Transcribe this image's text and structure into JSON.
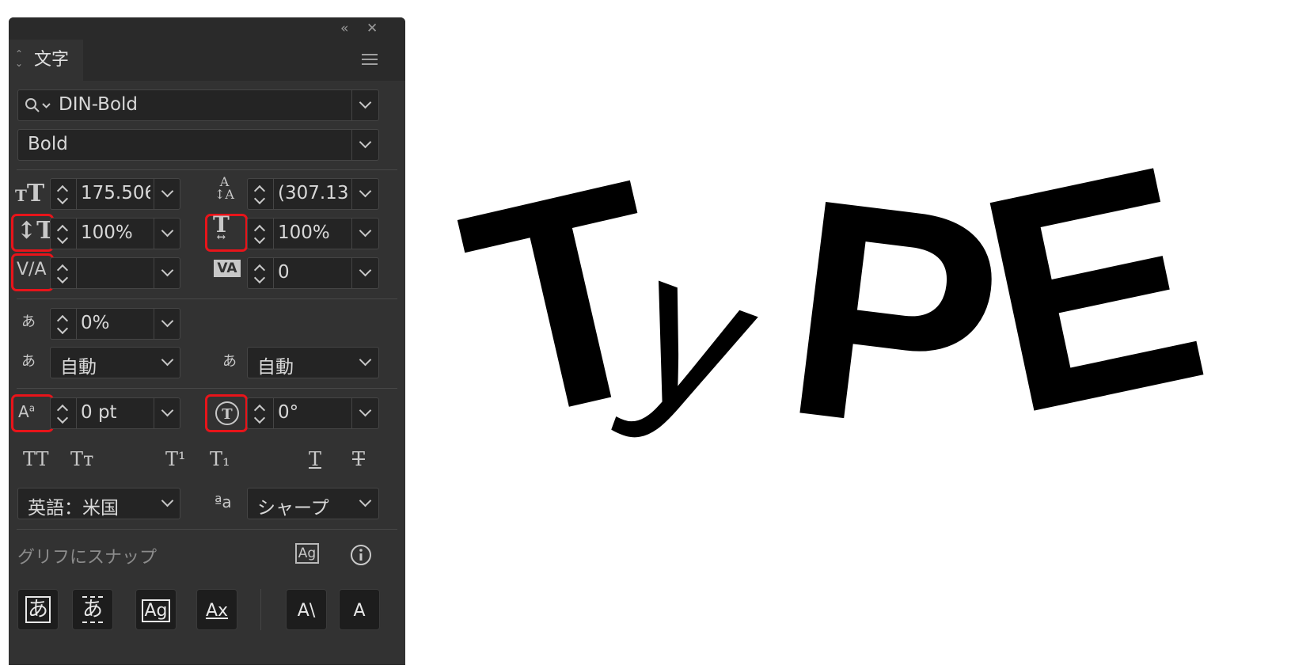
{
  "panel": {
    "title_icons": {
      "collapse": "«",
      "close": "✕"
    },
    "tab_label": "文字",
    "menu_icon": "hamburger-menu-icon",
    "font_family": "DIN-Bold",
    "font_style": "Bold",
    "font_size": "175.506",
    "leading": "(307.13",
    "vertical_scale": "100%",
    "horizontal_scale": "100%",
    "kerning": "",
    "tracking": "0",
    "tsume": "0%",
    "aki_left": "自動",
    "aki_right": "自動",
    "baseline_shift": "0 pt",
    "char_rotation": "0°",
    "style_buttons": [
      "TT",
      "Tт",
      "T¹",
      "T₁",
      "T",
      "T"
    ],
    "language": "英語：米国",
    "antialias_icon_label": "ªa",
    "antialias": "シャープ",
    "snap_label": "グリフにスナップ",
    "bottom_buttons": [
      "あ",
      "あ",
      "Ag",
      "Ax",
      "A\\",
      "A"
    ]
  },
  "canvas": {
    "letters": [
      "T",
      "y",
      "P",
      "E"
    ]
  },
  "colors": {
    "highlight": "#e8141a",
    "panel_bg": "#323232",
    "field_bg": "#242424"
  }
}
